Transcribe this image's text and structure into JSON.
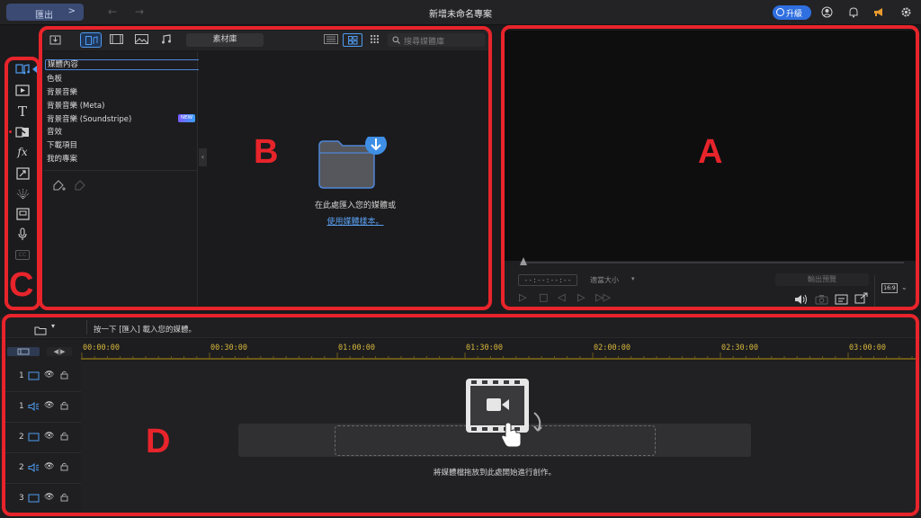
{
  "topbar": {
    "export_label": "匯出",
    "title": "新增未命名專案",
    "upgrade_label": "升級"
  },
  "media": {
    "library_label": "素材庫",
    "search_placeholder": "搜尋媒體庫",
    "tree": [
      "媒體內容",
      "色板",
      "背景音樂",
      "背景音樂 (Meta)",
      "背景音樂 (Soundstripe)",
      "音效",
      "下載項目",
      "我的專案"
    ],
    "new_badge": "NEW",
    "import_text": "在此處匯入您的媒體或",
    "sample_link": "使用媒體樣本。"
  },
  "preview": {
    "timecode": "--:--:--:--",
    "fit_label": "適當大小",
    "export_preview_label": "輸出預覽",
    "aspect_ratio": "16:9"
  },
  "timeline": {
    "hint": "按一下 [匯入] 載入您的媒體。",
    "ruler": [
      "00:00:00",
      "00:30:00",
      "01:00:00",
      "01:30:00",
      "02:00:00",
      "02:30:00",
      "03:00:00"
    ],
    "tracks": [
      {
        "num": "1",
        "type": "video"
      },
      {
        "num": "1",
        "type": "audio"
      },
      {
        "num": "2",
        "type": "video"
      },
      {
        "num": "2",
        "type": "audio"
      },
      {
        "num": "3",
        "type": "video"
      }
    ],
    "drag_text": "將媒體檔拖放到此處開始進行創作。"
  },
  "annotations": {
    "a": "A",
    "b": "B",
    "c": "C",
    "d": "D"
  },
  "colors": {
    "annotation_red": "#e8242b",
    "accent_blue": "#2f6fe0",
    "ruler_gold": "#d8b83c"
  }
}
